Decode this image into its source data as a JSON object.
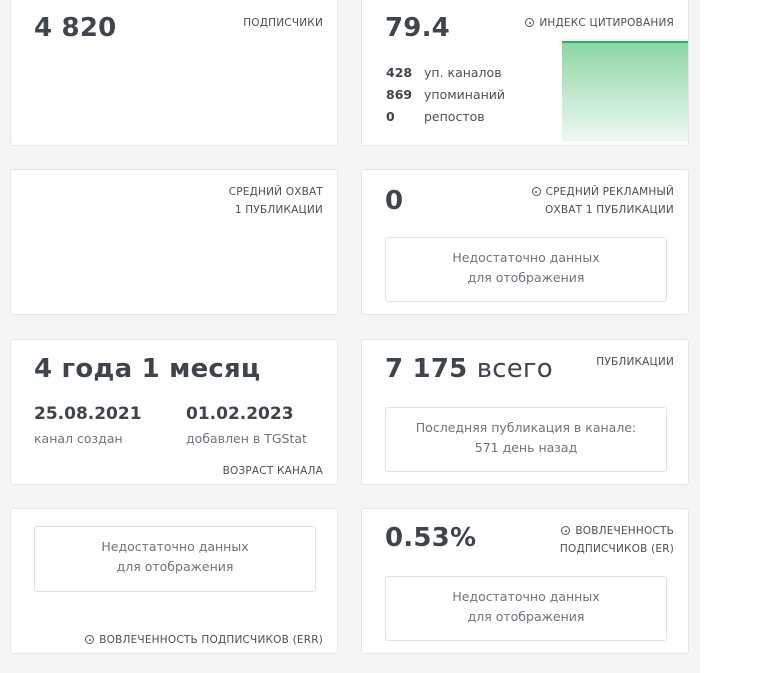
{
  "subscribers": {
    "value": "4 820",
    "label": "ПОДПИСЧИКИ"
  },
  "citation": {
    "value": "79.4",
    "label": "ИНДЕКС ЦИТИРОВАНИЯ",
    "rows": [
      {
        "num": "428",
        "text": "уп. каналов"
      },
      {
        "num": "869",
        "text": "упоминаний"
      },
      {
        "num": "0",
        "text": "репостов"
      }
    ],
    "accent": "#2fb35a"
  },
  "avg_reach": {
    "label_line1": "СРЕДНИЙ ОХВАТ",
    "label_line2": "1 ПУБЛИКАЦИИ"
  },
  "ad_reach": {
    "value": "0",
    "label_line1": "СРЕДНИЙ РЕКЛАМНЫЙ",
    "label_line2": "ОХВАТ 1 ПУБЛИКАЦИИ",
    "nodata_line1": "Недостаточно данных",
    "nodata_line2": "для отображения"
  },
  "age": {
    "value": "4 года 1 месяц",
    "created_date": "25.08.2021",
    "created_label": "канал создан",
    "added_date": "01.02.2023",
    "added_label": "добавлен в TGStat",
    "label": "ВОЗРАСТ КАНАЛА"
  },
  "publications": {
    "count": "7 175",
    "count_suffix": "всего",
    "label": "ПУБЛИКАЦИИ",
    "last_line1": "Последняя публикация в канале:",
    "last_line2": "571 день назад"
  },
  "err": {
    "nodata_line1": "Недостаточно данных",
    "nodata_line2": "для отображения",
    "label": "ВОВЛЕЧЕННОСТЬ ПОДПИСЧИКОВ (ERR)"
  },
  "er": {
    "value": "0.53%",
    "label_line1": "ВОВЛЕЧЕННОСТЬ",
    "label_line2": "ПОДПИСЧИКОВ (ER)",
    "nodata_line1": "Недостаточно данных",
    "nodata_line2": "для отображения"
  }
}
